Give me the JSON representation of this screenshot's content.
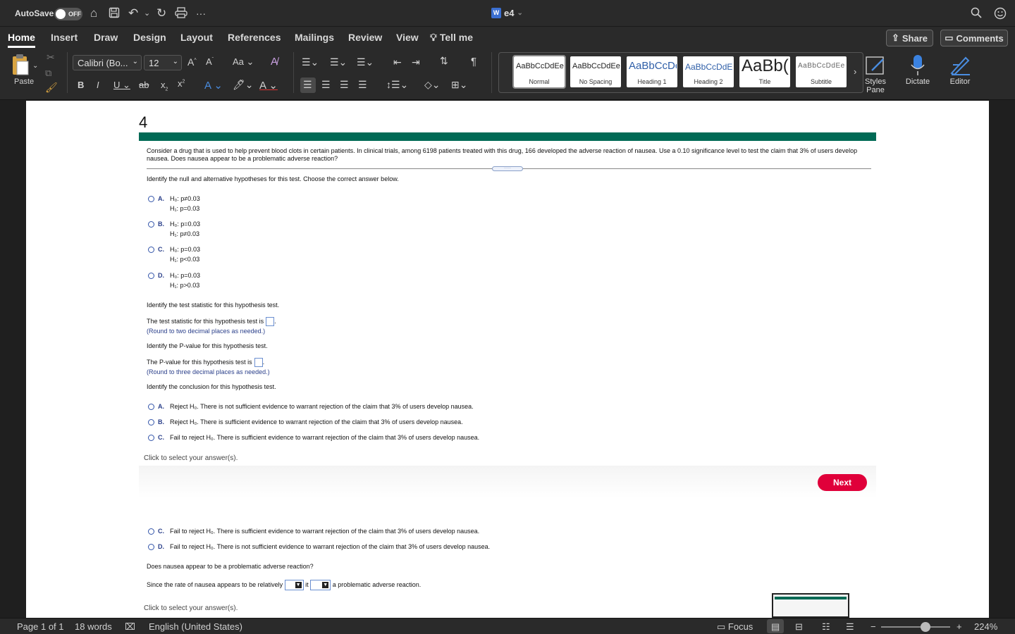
{
  "titlebar": {
    "autosave_label": "AutoSave",
    "autosave_state": "OFF",
    "document_title": "e4"
  },
  "tabs": [
    "Home",
    "Insert",
    "Draw",
    "Design",
    "Layout",
    "References",
    "Mailings",
    "Review",
    "View",
    "Tell me"
  ],
  "active_tab": "Home",
  "actions": {
    "share": "Share",
    "comments": "Comments"
  },
  "ribbon": {
    "paste_label": "Paste",
    "font_name": "Calibri (Bo...",
    "font_size": "12",
    "styles": [
      {
        "sample": "AaBbCcDdEe",
        "name": "Normal"
      },
      {
        "sample": "AaBbCcDdEe",
        "name": "No Spacing"
      },
      {
        "sample": "AaBbCcDc",
        "name": "Heading 1"
      },
      {
        "sample": "AaBbCcDdEe",
        "name": "Heading 2"
      },
      {
        "sample": "AaBb(",
        "name": "Title"
      },
      {
        "sample": "AaBbCcDdEe",
        "name": "Subtitle"
      }
    ],
    "styles_pane": "Styles\nPane",
    "dictate": "Dictate",
    "editor": "Editor"
  },
  "document": {
    "heading": "4",
    "question": "Consider a drug that is used to help prevent blood clots in certain patients. In clinical trials, among 6198 patients treated with this drug, 166 developed the adverse reaction of nausea. Use a 0.10 significance level to test the claim that 3% of users develop nausea. Does nausea appear to be a problematic adverse reaction?",
    "hypotheses_prompt": "Identify the null and alternative hypotheses for this test. Choose the correct answer below.",
    "hypotheses_options": [
      {
        "letter": "A.",
        "h0": "H₀: p≠0.03",
        "h1": "H₁: p=0.03"
      },
      {
        "letter": "B.",
        "h0": "H₀: p=0.03",
        "h1": "H₁: p≠0.03"
      },
      {
        "letter": "C.",
        "h0": "H₀: p=0.03",
        "h1": "H₁: p<0.03"
      },
      {
        "letter": "D.",
        "h0": "H₀: p=0.03",
        "h1": "H₁: p>0.03"
      }
    ],
    "stat_prompt": "Identify the test statistic for this hypothesis test.",
    "stat_line": "The test statistic for this hypothesis test is",
    "stat_note": "(Round to two decimal places as needed.)",
    "pvalue_prompt": "Identify the P-value for this hypothesis test.",
    "pvalue_line": "The P-value for this hypothesis test is",
    "pvalue_note": "(Round to three decimal places as needed.)",
    "conclusion_prompt": "Identify the conclusion for this hypothesis test.",
    "conclusion_options": [
      {
        "letter": "A.",
        "text": "Reject H₀. There is not sufficient evidence to warrant rejection of the claim that 3% of users develop nausea."
      },
      {
        "letter": "B.",
        "text": "Reject H₀. There is sufficient evidence to warrant rejection of the claim that 3% of users develop nausea."
      },
      {
        "letter": "C.",
        "text": "Fail to reject H₀. There is sufficient evidence to warrant rejection of the claim that 3% of users develop nausea."
      }
    ],
    "click_hint": "Click to select your answer(s).",
    "next_label": "Next",
    "conclusion_options_2": [
      {
        "letter": "C.",
        "text": "Fail to reject H₀. There is sufficient evidence to warrant rejection of the claim that 3% of users develop nausea."
      },
      {
        "letter": "D.",
        "text": "Fail to reject H₀. There is not sufficient evidence to warrant rejection of the claim that 3% of users develop nausea."
      }
    ],
    "problematic_prompt": "Does nausea appear to be a problematic adverse reaction?",
    "since_prefix": "Since the rate of nausea appears to be relatively",
    "since_mid": "it",
    "since_suffix": "a problematic adverse reaction.",
    "click_hint_2": "Click to select your answer(s)."
  },
  "statusbar": {
    "page": "Page 1 of 1",
    "words": "18 words",
    "language": "English (United States)",
    "focus": "Focus",
    "zoom": "224%"
  }
}
